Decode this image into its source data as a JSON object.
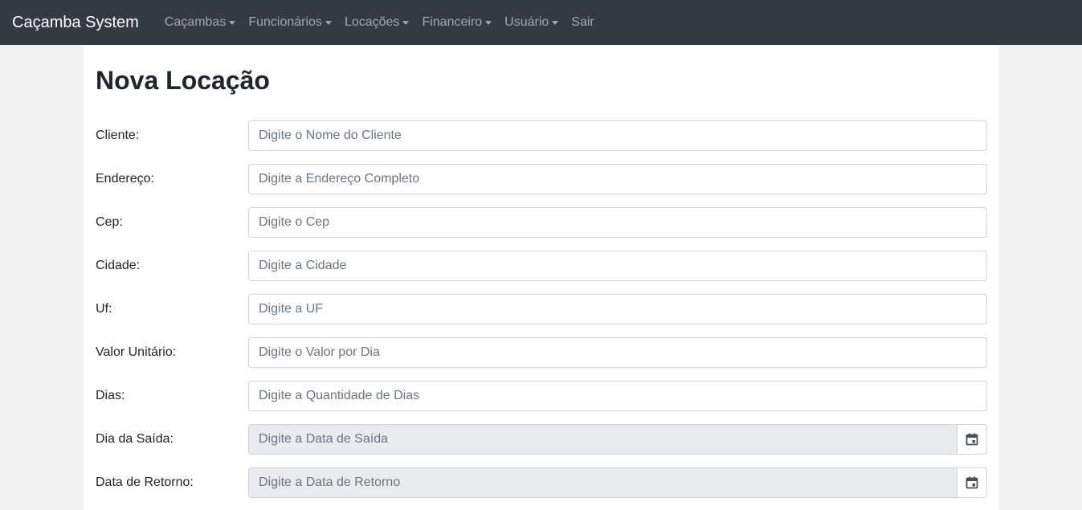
{
  "navbar": {
    "brand": "Caçamba System",
    "items": [
      {
        "label": "Caçambas",
        "dropdown": true
      },
      {
        "label": "Funcionários",
        "dropdown": true
      },
      {
        "label": "Locações",
        "dropdown": true
      },
      {
        "label": "Financeiro",
        "dropdown": true
      },
      {
        "label": "Usuário",
        "dropdown": true
      },
      {
        "label": "Sair",
        "dropdown": false
      }
    ]
  },
  "form": {
    "title": "Nova Locação",
    "fields": [
      {
        "label": "Cliente:",
        "placeholder": "Digite o Nome do Cliente",
        "value": ""
      },
      {
        "label": "Endereço:",
        "placeholder": "Digite a Endereço Completo",
        "value": ""
      },
      {
        "label": "Cep:",
        "placeholder": "Digite o Cep",
        "value": ""
      },
      {
        "label": "Cidade:",
        "placeholder": "Digite a Cidade",
        "value": ""
      },
      {
        "label": "Uf:",
        "placeholder": "Digite a UF",
        "value": ""
      },
      {
        "label": "Valor Unitário:",
        "placeholder": "Digite o Valor por Dia",
        "value": ""
      },
      {
        "label": "Dias:",
        "placeholder": "Digite a Quantidade de Dias",
        "value": ""
      },
      {
        "label": "Dia da Saída:",
        "placeholder": "Digite a Data de Saída",
        "value": "",
        "icon": "calendar-icon"
      },
      {
        "label": "Data de Retorno:",
        "placeholder": "Digite a Data de Retorno",
        "value": "",
        "icon": "calendar-icon"
      }
    ]
  },
  "colors": {
    "navbar_bg": "#343a40",
    "readonly_input_bg": "#e9ecef",
    "page_bg": "#f2f2f2"
  }
}
